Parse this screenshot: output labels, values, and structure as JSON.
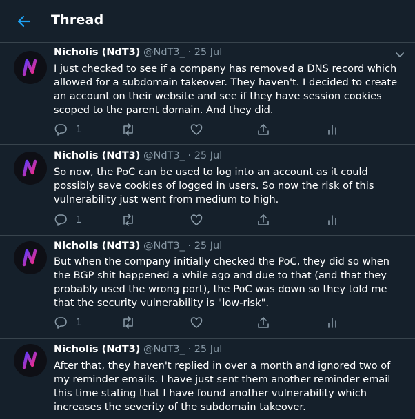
{
  "header": {
    "title": "Thread",
    "back_icon": "arrow-left-icon"
  },
  "colors": {
    "accent": "#1da1f2",
    "background": "#15202b",
    "muted": "#8899a6",
    "divider": "#38444d"
  },
  "tweets": [
    {
      "author_name": "Nicholis (NdT3)",
      "handle": "@NdT3_",
      "separator": "·",
      "date": "25 Jul",
      "text": "I just checked to see if a company has removed a DNS record which allowed for a subdomain takeover. They haven't. I decided to create an account on their website and see if they have session cookies scoped to the parent domain. And they did.",
      "reply_count": "1"
    },
    {
      "author_name": "Nicholis (NdT3)",
      "handle": "@NdT3_",
      "separator": "·",
      "date": "25 Jul",
      "text": "So now, the PoC can be used to log into an account as it could possibly save cookies of logged in users. So now the risk of this vulnerability just went from medium to high.",
      "reply_count": "1"
    },
    {
      "author_name": "Nicholis (NdT3)",
      "handle": "@NdT3_",
      "separator": "·",
      "date": "25 Jul",
      "text": "But when the company initially checked the PoC, they did so when the BGP shit happened a while ago and due to that (and that they probably used the wrong port), the PoC was down so they told me that the security vulnerability is \"low-risk\".",
      "reply_count": "1"
    },
    {
      "author_name": "Nicholis (NdT3)",
      "handle": "@NdT3_",
      "separator": "·",
      "date": "25 Jul",
      "text": "After that, they haven't replied in over a month and ignored two of my reminder emails. I have just sent them another reminder email this time stating that I have found another vulnerability which increases the severity of the subdomain takeover.",
      "reply_count": ""
    }
  ]
}
